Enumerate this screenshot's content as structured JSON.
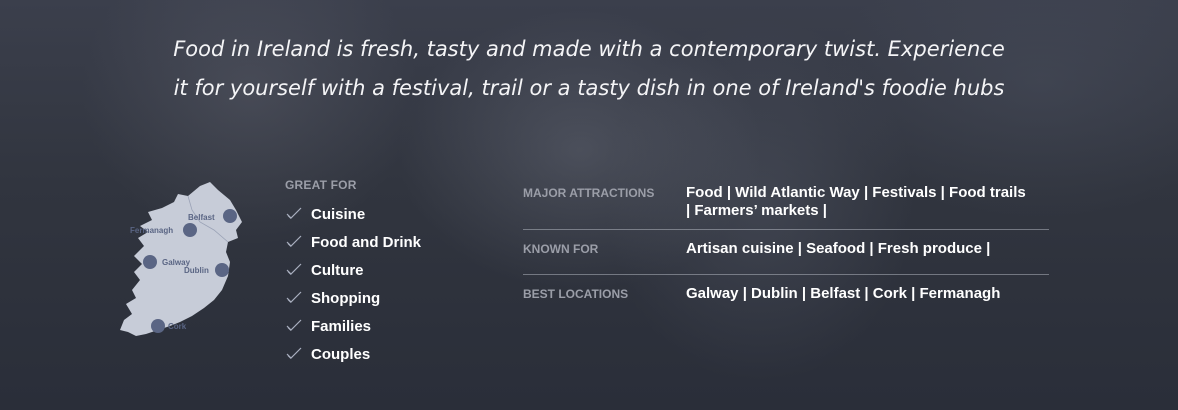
{
  "intro": {
    "line1": "Food in Ireland is fresh, tasty and made with a contemporary twist. Experience",
    "line2": "it for yourself with a festival, trail or a tasty dish in one of Ireland's foodie hubs"
  },
  "map": {
    "locations": [
      {
        "name": "Belfast"
      },
      {
        "name": "Fermanagh"
      },
      {
        "name": "Galway"
      },
      {
        "name": "Dublin"
      },
      {
        "name": "Cork"
      }
    ],
    "colors": {
      "land": "#c7ccd8",
      "pin": "#5a6584"
    }
  },
  "great_for": {
    "label": "GREAT FOR",
    "items": [
      "Cuisine",
      "Food and Drink",
      "Culture",
      "Shopping",
      "Families",
      "Couples"
    ]
  },
  "info": {
    "major_attractions": {
      "label": "MAJOR ATTRACTIONS",
      "line1": "Food | Wild Atlantic Way | Festivals | Food trails",
      "line2": "| Farmers’ markets |"
    },
    "known_for": {
      "label": "KNOWN FOR",
      "value": "Artisan cuisine | Seafood | Fresh produce |"
    },
    "best_locations": {
      "label": "BEST LOCATIONS",
      "value": "Galway | Dublin | Belfast | Cork | Fermanagh"
    }
  }
}
